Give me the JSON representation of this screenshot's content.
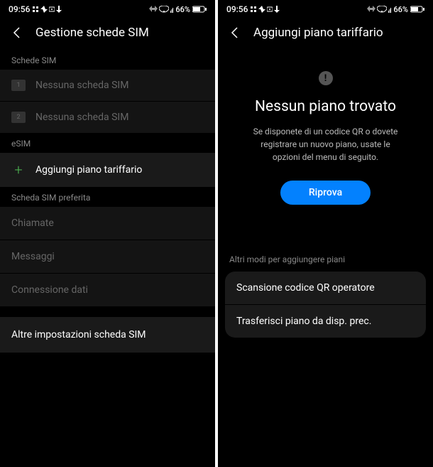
{
  "status": {
    "time": "09:56",
    "battery": "66%"
  },
  "left_screen": {
    "title": "Gestione schede SIM",
    "sections": {
      "sim_cards": {
        "label": "Schede SIM",
        "sim1": "Nessuna scheda SIM",
        "sim2": "Nessuna scheda SIM"
      },
      "esim": {
        "label": "eSIM",
        "add_plan": "Aggiungi piano tariffario"
      },
      "preferred": {
        "label": "Scheda SIM preferita",
        "calls": "Chiamate",
        "messages": "Messaggi",
        "data": "Connessione dati"
      },
      "other": "Altre impostazioni scheda SIM"
    }
  },
  "right_screen": {
    "title": "Aggiungi piano tariffario",
    "content": {
      "heading": "Nessun piano trovato",
      "description": "Se disponete di un codice QR o dovete registrare un nuovo piano, usate le opzioni del menu di seguito.",
      "retry_button": "Riprova"
    },
    "alternatives": {
      "label": "Altri modi per aggiungere piani",
      "scan_qr": "Scansione codice QR operatore",
      "transfer": "Trasferisci piano da disp. prec."
    }
  }
}
